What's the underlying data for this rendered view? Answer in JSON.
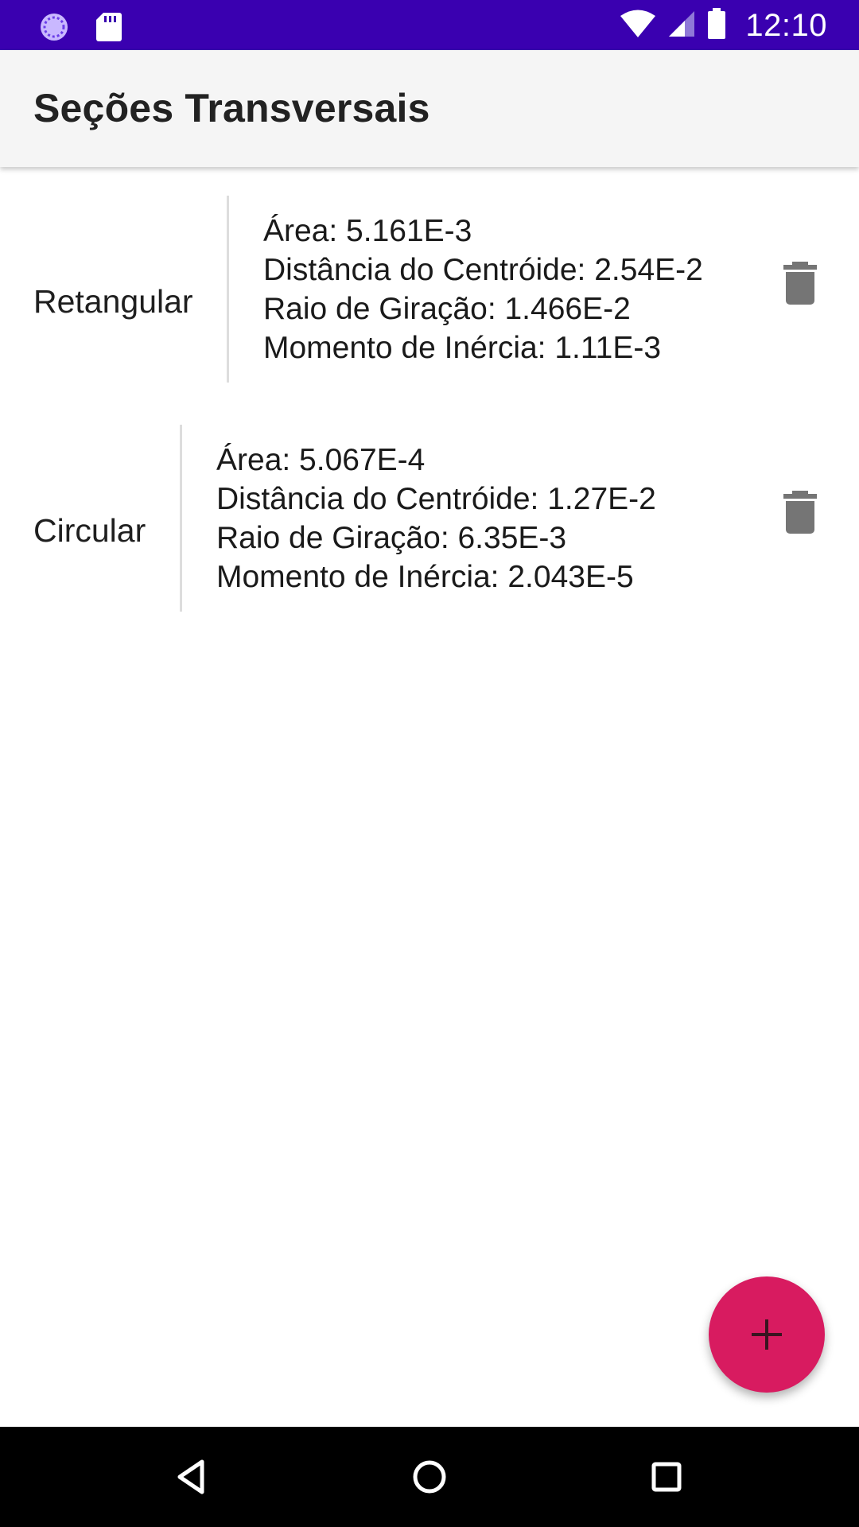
{
  "status_bar": {
    "time": "12:10",
    "background": "#3a00b0",
    "left_icons": [
      "sync-icon",
      "sd-card-icon"
    ],
    "right_icons": [
      "wifi-icon",
      "cell-signal-icon",
      "battery-icon"
    ]
  },
  "app_bar": {
    "title": "Seções Transversais"
  },
  "sections": [
    {
      "name": "Retangular",
      "properties": [
        "Área: 5.161E-3",
        "Distância do Centróide: 2.54E-2",
        "Raio de Giração: 1.466E-2",
        "Momento de Inércia: 1.11E-3"
      ],
      "action_icon": "trash-icon"
    },
    {
      "name": "Circular",
      "properties": [
        "Área: 5.067E-4",
        "Distância do Centróide: 1.27E-2",
        "Raio de Giração: 6.35E-3",
        "Momento de Inércia: 2.043E-5"
      ],
      "action_icon": "trash-icon"
    }
  ],
  "fab": {
    "icon": "plus-icon",
    "color": "#d81b60"
  },
  "nav_bar": {
    "buttons": [
      "back-icon",
      "home-icon",
      "recents-icon"
    ]
  }
}
